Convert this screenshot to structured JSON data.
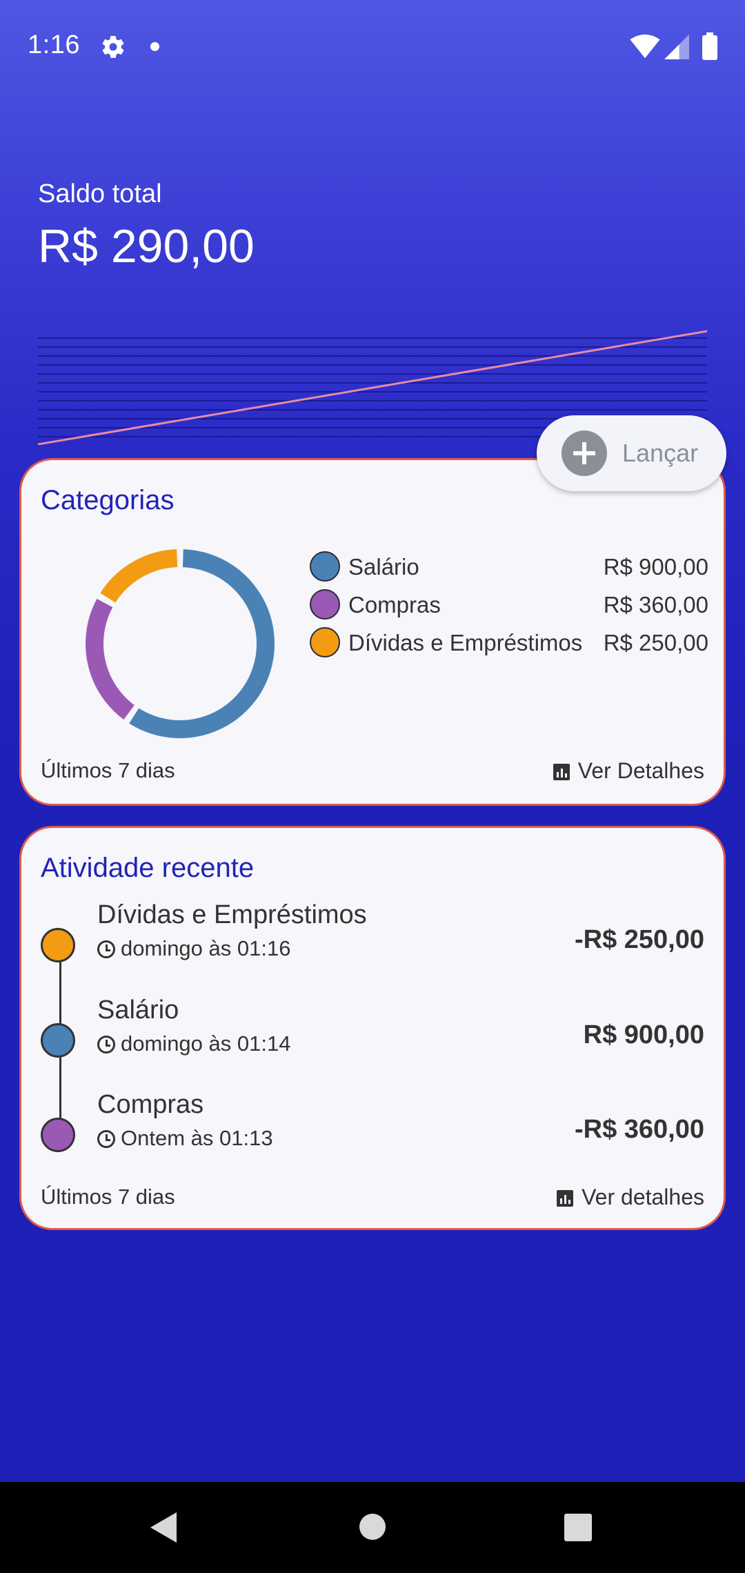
{
  "status_bar": {
    "time": "1:16"
  },
  "balance": {
    "label": "Saldo total",
    "value": "R$ 290,00"
  },
  "launch_button": {
    "label": "Lançar"
  },
  "categories_card": {
    "title": "Categorias",
    "items": [
      {
        "name": "Salário",
        "value": "R$ 900,00",
        "color": "#4a82b5",
        "amount": 900
      },
      {
        "name": "Compras",
        "value": "R$ 360,00",
        "color": "#9b59b6",
        "amount": 360
      },
      {
        "name": "Dívidas e Empréstimos",
        "value": "R$ 250,00",
        "color": "#f39c12",
        "amount": 250
      }
    ],
    "period": "Últimos 7 dias",
    "details_label": "Ver Detalhes"
  },
  "activity_card": {
    "title": "Atividade recente",
    "items": [
      {
        "name": "Dívidas e Empréstimos",
        "time": "domingo às 01:16",
        "amount": "-R$ 250,00",
        "color": "#f39c12"
      },
      {
        "name": "Salário",
        "time": "domingo às 01:14",
        "amount": "R$ 900,00",
        "color": "#4a82b5"
      },
      {
        "name": "Compras",
        "time": "Ontem às 01:13",
        "amount": "-R$ 360,00",
        "color": "#9b59b6"
      }
    ],
    "period": "Últimos 7 dias",
    "details_label": "Ver detalhes"
  },
  "colors": {
    "accent": "#2124b5",
    "card_border": "#e05a4a",
    "chart_line": "#e88aa8"
  }
}
